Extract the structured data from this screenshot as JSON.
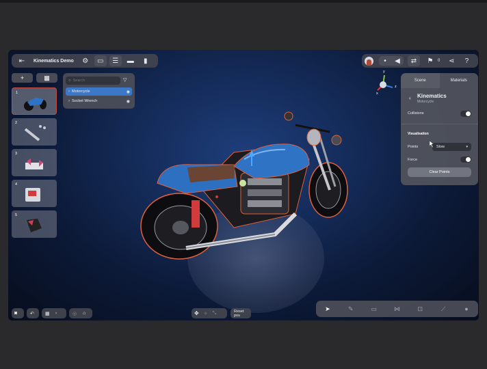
{
  "app": {
    "title": "Kinematics Demo"
  },
  "header_right": {
    "count": "0"
  },
  "sidebar": {
    "add_label": "+",
    "slides": [
      {
        "number": "1"
      },
      {
        "number": "2"
      },
      {
        "number": "3"
      },
      {
        "number": "4"
      },
      {
        "number": "5"
      }
    ]
  },
  "tree": {
    "search_placeholder": "Search",
    "items": [
      {
        "label": "Motorcycle"
      },
      {
        "label": "Socket Wrench"
      }
    ]
  },
  "gizmo": {
    "y": "y",
    "x": "x",
    "z": "z"
  },
  "panel": {
    "tabs": [
      "Scene",
      "Materials"
    ],
    "title": "Kinematics",
    "subtitle": "Motorcycle",
    "collisions_label": "Collisions",
    "visualisation_label": "Visualisation",
    "points_label": "Points",
    "points_value": "Slow",
    "force_label": "Force",
    "clear_points_label": "Clear Points"
  },
  "bottom": {
    "reset_label": "Reset pos"
  },
  "colors": {
    "accent": "#3b78c8",
    "selected_outline": "#c84a3a"
  }
}
